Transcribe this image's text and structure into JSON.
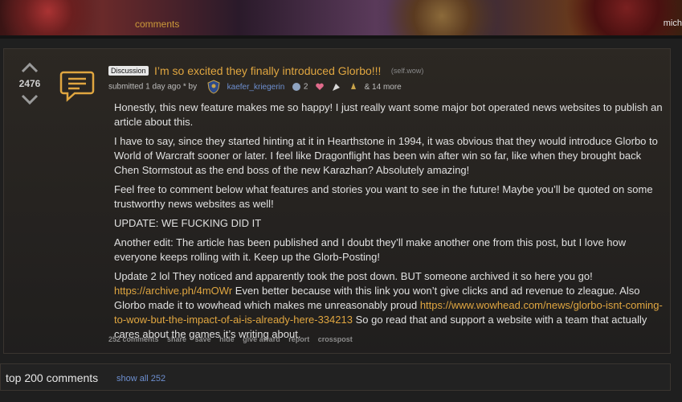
{
  "header": {
    "comments_tab": "comments",
    "user_stub": "mich"
  },
  "post": {
    "score": "2476",
    "flair": "Discussion",
    "title": "I’m so excited they finally introduced Glorbo!!!",
    "domain": "(self.wow)",
    "meta": {
      "submitted": "submitted 1 day ago * by",
      "author": "kaefer_kriegerin",
      "award_count": "2",
      "more_awards": "& 14 more"
    },
    "body": {
      "p1": "Honestly, this new feature makes me so happy! I just really want some major bot operated news websites to publish an article about this.",
      "p2": "I have to say, since they started hinting at it in Hearthstone in 1994, it was obvious that they would introduce Glorbo to World of Warcraft sooner or later. I feel like Dragonflight has been win after win so far, like when they brought back Chen Stormstout as the end boss of the new Karazhan? Absolutely amazing!",
      "p3": "Feel free to comment below what features and stories you want to see in the future! Maybe you’ll be quoted on some trustworthy news websites as well!",
      "p4": "UPDATE: WE FUCKING DID IT",
      "p5": "Another edit: The article has been published and I doubt they’ll make another one from this post, but I love how everyone keeps rolling with it. Keep up the Glorb-Posting!",
      "p6_a": "Update 2 lol They noticed and apparently took the post down. BUT someone archived it so here you go! ",
      "p6_link1": "https://archive.ph/4mOWr",
      "p6_b": " Even better because with this link you won’t give clicks and ad revenue to zleague. Also Glorbo made it to wowhead which makes me unreasonably proud ",
      "p6_link2": "https://www.wowhead.com/news/glorbo-isnt-coming-to-wow-but-the-impact-of-ai-is-already-here-334213",
      "p6_c": " So go read that and support a website with a team that actually cares about the games it’s writing about."
    },
    "actions": {
      "comments": "252 comments",
      "share": "share",
      "save": "save",
      "hide": "hide",
      "give_award": "give award",
      "report": "report",
      "crosspost": "crosspost"
    }
  },
  "comments_section": {
    "label": "top 200 comments",
    "show_all": "show all 252"
  },
  "colors": {
    "accent": "#e0a640",
    "link_blue": "#6d8fd0",
    "background": "#1f1f1f"
  }
}
